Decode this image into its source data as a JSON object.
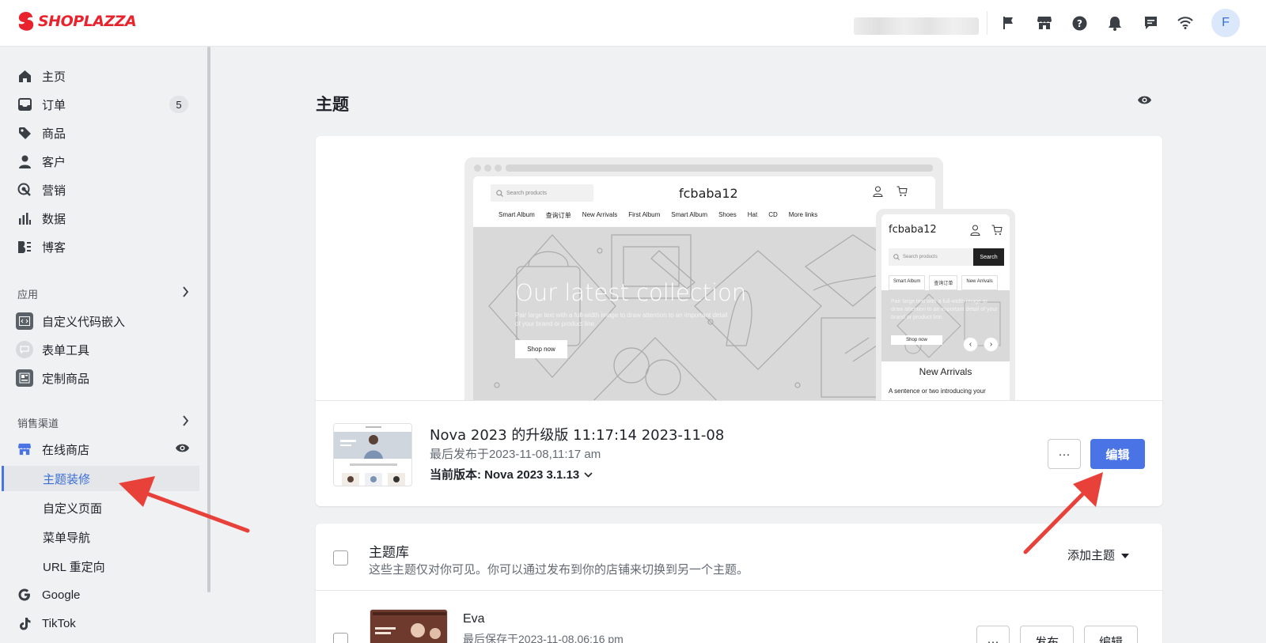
{
  "brand": {
    "logo_text": "SHOPLAZZA",
    "accent": "#e8232e"
  },
  "topbar": {
    "icons": [
      "flag-icon",
      "store-icon",
      "help-icon",
      "bell-icon",
      "chat-icon",
      "wifi-icon"
    ],
    "avatar_letter": "F"
  },
  "sidebar": {
    "items": [
      {
        "label": "主页",
        "icon": "home-icon"
      },
      {
        "label": "订单",
        "icon": "inbox-icon",
        "badge": "5"
      },
      {
        "label": "商品",
        "icon": "tag-icon"
      },
      {
        "label": "客户",
        "icon": "person-icon"
      },
      {
        "label": "营销",
        "icon": "marketing-icon"
      },
      {
        "label": "数据",
        "icon": "bar-chart-icon"
      },
      {
        "label": "博客",
        "icon": "blog-icon"
      }
    ],
    "apps_label": "应用",
    "apps": [
      {
        "label": "自定义代码嵌入",
        "icon": "code-icon"
      },
      {
        "label": "表单工具",
        "icon": "form-icon"
      },
      {
        "label": "定制商品",
        "icon": "custom-product-icon"
      }
    ],
    "channels_label": "销售渠道",
    "online_store": "在线商店",
    "sub_items": [
      "主题装修",
      "自定义页面",
      "菜单导航",
      "URL 重定向"
    ],
    "google": "Google",
    "tiktok": "TikTok"
  },
  "main": {
    "title": "主题",
    "preview": {
      "search_placeholder": "Search products",
      "store_name": "fcbaba12",
      "nav": [
        "Smart Album",
        "查询订单",
        "New Arrivals",
        "First Album",
        "Smart Album",
        "Shoes",
        "Hat",
        "CD",
        "More links"
      ],
      "hero_title": "Our latest collection",
      "hero_sub": "Pair large text with a full-width image to draw attention to an important detail of your brand or product line.",
      "hero_button": "Shop now",
      "mobile_search_button": "Search",
      "mobile_tags": [
        "Smart Album",
        "查询订单",
        "New Arrivals"
      ],
      "mobile_hero_sub": "Pair large text with a full-width image to draw attention to an important detail of your brand or product line.",
      "mobile_hero_button": "Shop now",
      "mobile_section_title": "New Arrivals",
      "mobile_section_sub": "A sentence or two introducing your"
    },
    "current_theme": {
      "name": "Nova 2023 的升级版 11:17:14 2023-11-08",
      "published": "最后发布于2023-11-08,11:17 am",
      "version": "当前版本: Nova 2023 3.1.13",
      "more_button": "···",
      "edit_button": "编辑"
    },
    "library": {
      "title": "主题库",
      "description": "这些主题仅对你可见。你可以通过发布到你的店铺来切换到另一个主题。",
      "add_button": "添加主题",
      "themes": [
        {
          "name": "Eva",
          "saved": "最后保存于2023-11-08,06:16 pm",
          "more": "···",
          "publish": "发布",
          "edit": "编辑"
        }
      ]
    }
  },
  "colors": {
    "primary": "#4a74e6",
    "annotation_arrow": "#e8413a"
  }
}
